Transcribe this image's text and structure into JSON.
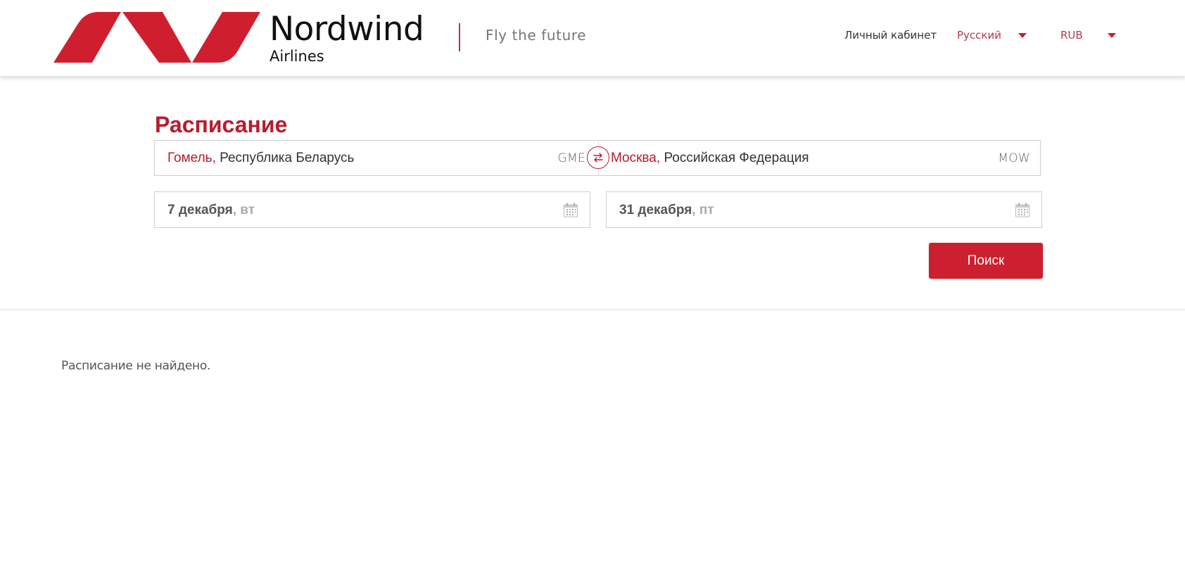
{
  "header": {
    "brand_name": "Nordwind",
    "brand_sub": "Airlines",
    "tagline": "Fly the future",
    "logo_icon": "nordwind-logo-icon",
    "nav": {
      "account": "Личный кабинет",
      "language": "Русский",
      "currency": "RUB"
    }
  },
  "colors": {
    "accent": "#cc1f2f",
    "title": "#b71c2e",
    "link": "#b5394b"
  },
  "page": {
    "title": "Расписание"
  },
  "search_form": {
    "origin": {
      "city": "Гомель",
      "separator": ", ",
      "country": "Республика Беларусь",
      "code": "GME"
    },
    "swap_icon": "swap-arrows-icon",
    "destination": {
      "city": "Москва",
      "separator": ", ",
      "country": "Российская Федерация",
      "code": "MOW"
    },
    "date_from": {
      "date": "7 декабря",
      "weekday": ", вт"
    },
    "date_to": {
      "date": "31 декабря",
      "weekday": ", пт"
    },
    "calendar_icon": "calendar-icon",
    "search_label": "Поиск"
  },
  "results": {
    "empty_message": "Расписание не найдено."
  }
}
